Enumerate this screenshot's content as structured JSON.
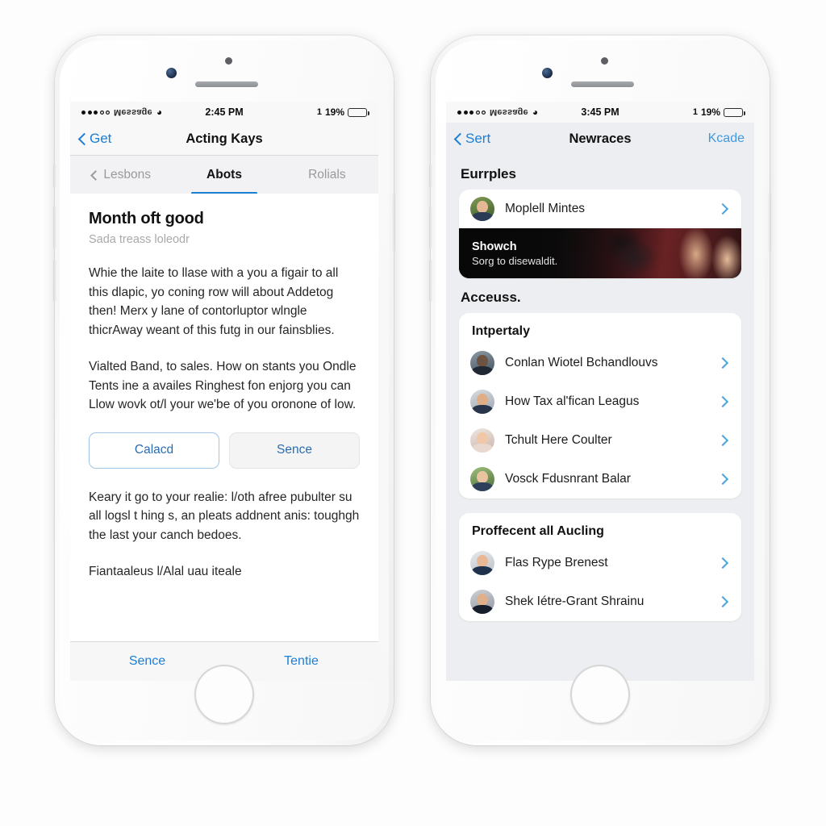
{
  "phones": {
    "left": {
      "status": {
        "carrier": "Меѕѕаgе",
        "time": "2:45 PM",
        "battery_percent": "19%",
        "charging_bolt": "1",
        "wifi_icon": "wifi-icon"
      },
      "nav": {
        "back_label": "Get",
        "title": "Acting Kays"
      },
      "tabs": [
        {
          "label": "Lesbons",
          "active": false,
          "has_chevron": true
        },
        {
          "label": "Abots",
          "active": true,
          "has_chevron": false
        },
        {
          "label": "Rolials",
          "active": false,
          "has_chevron": false
        }
      ],
      "article": {
        "title": "Month oft good",
        "subtitle": "Sada treass loleodr",
        "paragraph1": "Whie the laite to llase with a you a figair to all this dlapic, yo coning row will about Addetog then! Merx y lane of contorluptor wlngle thicrAway weant of this futg in our fainsblies.",
        "paragraph2": "Vialted Band, to sales. How on stants you Ondle Tents ine a availes Ringhest fon enjorg you can Llow wovk ot/l your we'be of you oronone of low.",
        "paragraph3": "Keary it go to your realie: l/oth afree pubulter su all logsl t hing s, an pleats addnent anis: toughgh the last your canch bedoes.",
        "paragraph4_cut": "Fiantaaleus l/Alal uau iteale",
        "button_primary": "Calacd",
        "button_secondary": "Sence"
      },
      "toolbar": {
        "left_label": "Sence",
        "right_label": "Tentie"
      }
    },
    "right": {
      "status": {
        "carrier": "Меѕѕаgе",
        "time": "3:45 PM",
        "battery_percent": "19%",
        "charging_bolt": "1",
        "wifi_icon": "wifi-icon"
      },
      "nav": {
        "back_label": "Sert",
        "title": "Newraces",
        "action_label": "Kcade"
      },
      "sections": [
        {
          "header": "Eurrples",
          "card_title": null,
          "rows": [
            {
              "label": "Moplell Mintes",
              "avatar": "avatar-1"
            }
          ],
          "banner": {
            "title": "Showch",
            "subtitle": "Sorg to disewaldit.",
            "name": "promo-banner"
          }
        },
        {
          "header": "Acceuss.",
          "card_title": "Intpertaly",
          "rows": [
            {
              "label": "Conlan Wiotel Bchandlouvs",
              "avatar": "avatar-2"
            },
            {
              "label": "How Tax al'fican Leagus",
              "avatar": "avatar-3"
            },
            {
              "label": "Tchult Here Coulter",
              "avatar": "avatar-4"
            },
            {
              "label": "Vosck Fdusnrant Balar",
              "avatar": "avatar-5"
            }
          ]
        },
        {
          "header": null,
          "card_title": "Proffecent all Aucling",
          "rows": [
            {
              "label": "Flas Rype Brenest",
              "avatar": "avatar-6"
            },
            {
              "label": "Shek Iétre-Grant Shrainu",
              "avatar": "avatar-7"
            }
          ]
        }
      ]
    }
  },
  "colors": {
    "accent_blue": "#1c7ed6",
    "link_blue": "#2b6cb0",
    "tab_underline": "#1b7fd1",
    "battery_green": "#23c034",
    "page_bg": "#eceef1",
    "chevron_blue": "#4aa3df"
  }
}
